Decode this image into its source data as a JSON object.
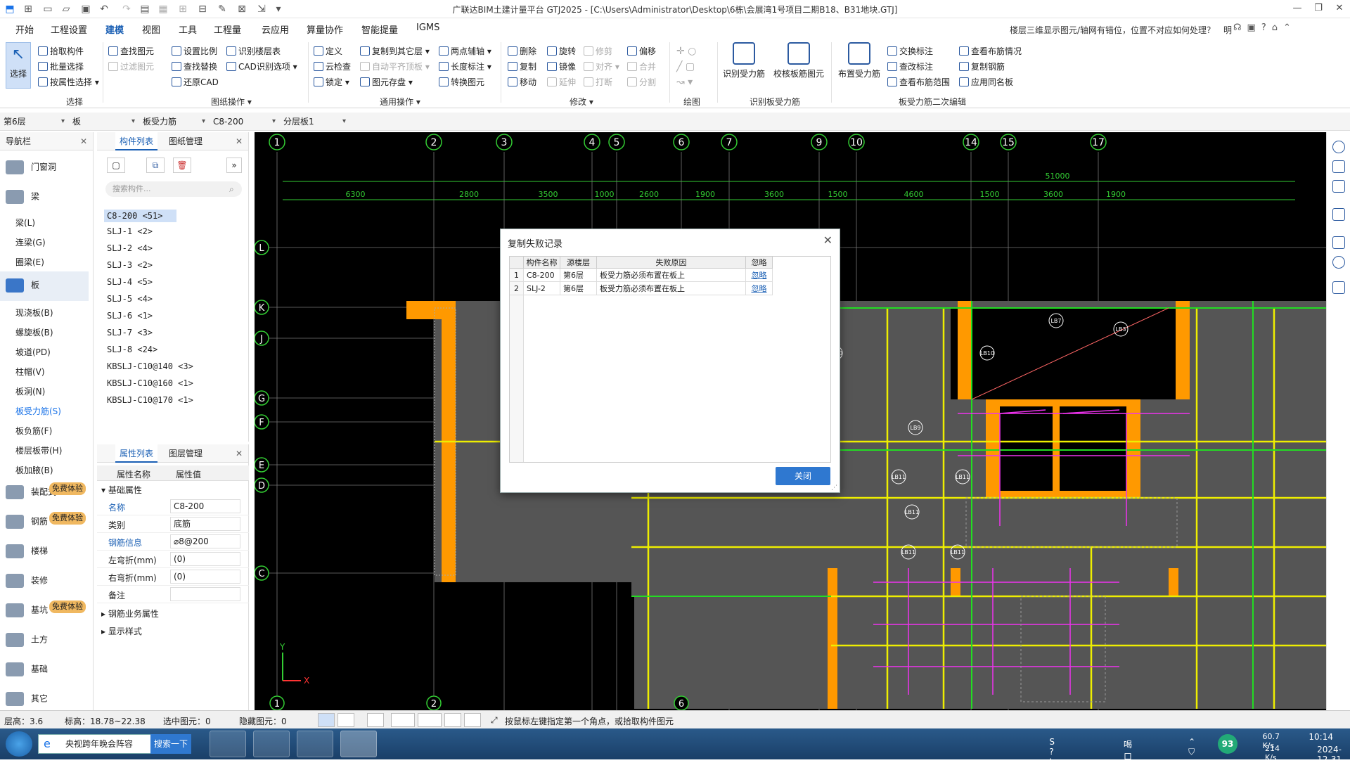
{
  "title": "广联达BIM土建计量平台 GTJ2025 - [C:\\Users\\Administrator\\Desktop\\6栋\\会展湾1号项目二期B18、B31地块.GTJ]",
  "menu": {
    "items": [
      "开始",
      "工程设置",
      "建模",
      "视图",
      "工具",
      "工程量",
      "云应用",
      "算量协作",
      "智能提量",
      "IGMS"
    ],
    "active": "建模",
    "tip": "楼层三维显示图元/轴网有错位，位置不对应如何处理？",
    "user": "明"
  },
  "ribbon": {
    "select": {
      "big": "选择",
      "items": [
        "拾取构件",
        "批量选择",
        "按属性选择"
      ],
      "group": "选择"
    },
    "drawing": {
      "items": [
        "查找图元",
        "过滤图元",
        "设置比例",
        "查找替换",
        "还原CAD",
        "识别楼层表",
        "CAD识别选项"
      ],
      "group": "图纸操作"
    },
    "general": {
      "items": [
        "定义",
        "复制到其它层",
        "两点辅轴",
        "云检查",
        "自动平齐顶板",
        "长度标注",
        "锁定",
        "图元存盘",
        "转换图元"
      ],
      "group": "通用操作"
    },
    "modify": {
      "items": [
        "删除",
        "旋转",
        "修剪",
        "偏移",
        "复制",
        "镜像",
        "对齐",
        "合并",
        "移动",
        "延伸",
        "打断",
        "分割"
      ],
      "group": "修改"
    },
    "draw": {
      "group": "绘图"
    },
    "recognize": {
      "items": [
        "识别受力筋",
        "校核板筋图元"
      ],
      "group": "识别板受力筋"
    },
    "edit2": {
      "items": [
        "布置受力筋",
        "交换标注",
        "查看布筋情况",
        "查改标注",
        "复制钢筋",
        "查看布筋范围",
        "应用同名板"
      ],
      "group": "板受力筋二次编辑"
    }
  },
  "filters": [
    "第6层",
    "板",
    "板受力筋",
    "C8-200",
    "分层板1"
  ],
  "nav": {
    "title": "导航栏",
    "categories": [
      "门窗洞",
      "梁",
      "板",
      "装配式",
      "钢筋",
      "楼梯",
      "装修",
      "基坑",
      "土方",
      "基础",
      "其它"
    ],
    "beam_subs": [
      "梁(L)",
      "连梁(G)",
      "圈梁(E)"
    ],
    "slab_subs": [
      "现浇板(B)",
      "螺旋板(B)",
      "坡道(PD)",
      "柱帽(V)",
      "板洞(N)",
      "板受力筋(S)",
      "板负筋(F)",
      "楼层板带(H)",
      "板加腋(B)"
    ],
    "badge": "免费体验"
  },
  "complist": {
    "tabs": [
      "构件列表",
      "图纸管理"
    ],
    "search_placeholder": "搜索构件...",
    "items": [
      "C8-200 <51>",
      "SLJ-1 <2>",
      "SLJ-2 <4>",
      "SLJ-3 <2>",
      "SLJ-4 <5>",
      "SLJ-5 <4>",
      "SLJ-6 <1>",
      "SLJ-7 <3>",
      "SLJ-8 <24>",
      "KBSLJ-C10@140 <3>",
      "KBSLJ-C10@160 <1>",
      "KBSLJ-C10@170 <1>"
    ]
  },
  "props": {
    "tabs": [
      "属性列表",
      "图层管理"
    ],
    "col_name": "属性名称",
    "col_value": "属性值",
    "group_basic": "基础属性",
    "rows": [
      {
        "name": "名称",
        "value": "C8-200"
      },
      {
        "name": "类别",
        "value": "底筋"
      },
      {
        "name": "钢筋信息",
        "value": "⌀8@200"
      },
      {
        "name": "左弯折(mm)",
        "value": "(0)"
      },
      {
        "name": "右弯折(mm)",
        "value": "(0)"
      },
      {
        "name": "备注",
        "value": ""
      }
    ],
    "group_business": "钢筋业务属性",
    "group_display": "显示样式"
  },
  "dialog": {
    "title": "复制失败记录",
    "headers": [
      "构件名称",
      "源楼层",
      "失败原因",
      "忽略"
    ],
    "rows": [
      {
        "n": "1",
        "name": "C8-200",
        "floor": "第6层",
        "reason": "板受力筋必须布置在板上",
        "ignore": "忽略"
      },
      {
        "n": "2",
        "name": "SLJ-2",
        "floor": "第6层",
        "reason": "板受力筋必须布置在板上",
        "ignore": "忽略"
      }
    ],
    "close": "关闭"
  },
  "canvas": {
    "axes_top": [
      "1",
      "2",
      "3",
      "4",
      "5",
      "6",
      "7",
      "9",
      "10",
      "14",
      "15",
      "17"
    ],
    "axes_left": [
      "L",
      "K",
      "J",
      "G",
      "F",
      "E",
      "D",
      "C"
    ],
    "dims": [
      "6300",
      "2800",
      "3500",
      "1000",
      "2600",
      "1900",
      "3600",
      "1500",
      "4600",
      "1500",
      "3600",
      "1900"
    ],
    "total": "51000",
    "slab_labels": [
      "LB8",
      "LB7",
      "LB3",
      "LB10",
      "LB10",
      "LB9",
      "LB11",
      "LB11",
      "LB11",
      "LB11",
      "LB11"
    ],
    "bottom_axes": [
      "1",
      "2",
      "6"
    ]
  },
  "status": {
    "floor_height": "层高：3.6",
    "elevation": "标高：18.78~22.38",
    "selected": "选中图元：0",
    "hidden": "隐藏图元：0",
    "hint": "按鼠标左键指定第一个角点，或拾取构件图元"
  },
  "taskbar": {
    "search_text": "央视跨年晚会阵容",
    "search_btn": "搜索一下",
    "weather": "喝口水",
    "net_up": "60.7 K/s",
    "net_down": "214 K/s",
    "cpu": "93",
    "time": "10:14",
    "date": "2024-12-31"
  }
}
